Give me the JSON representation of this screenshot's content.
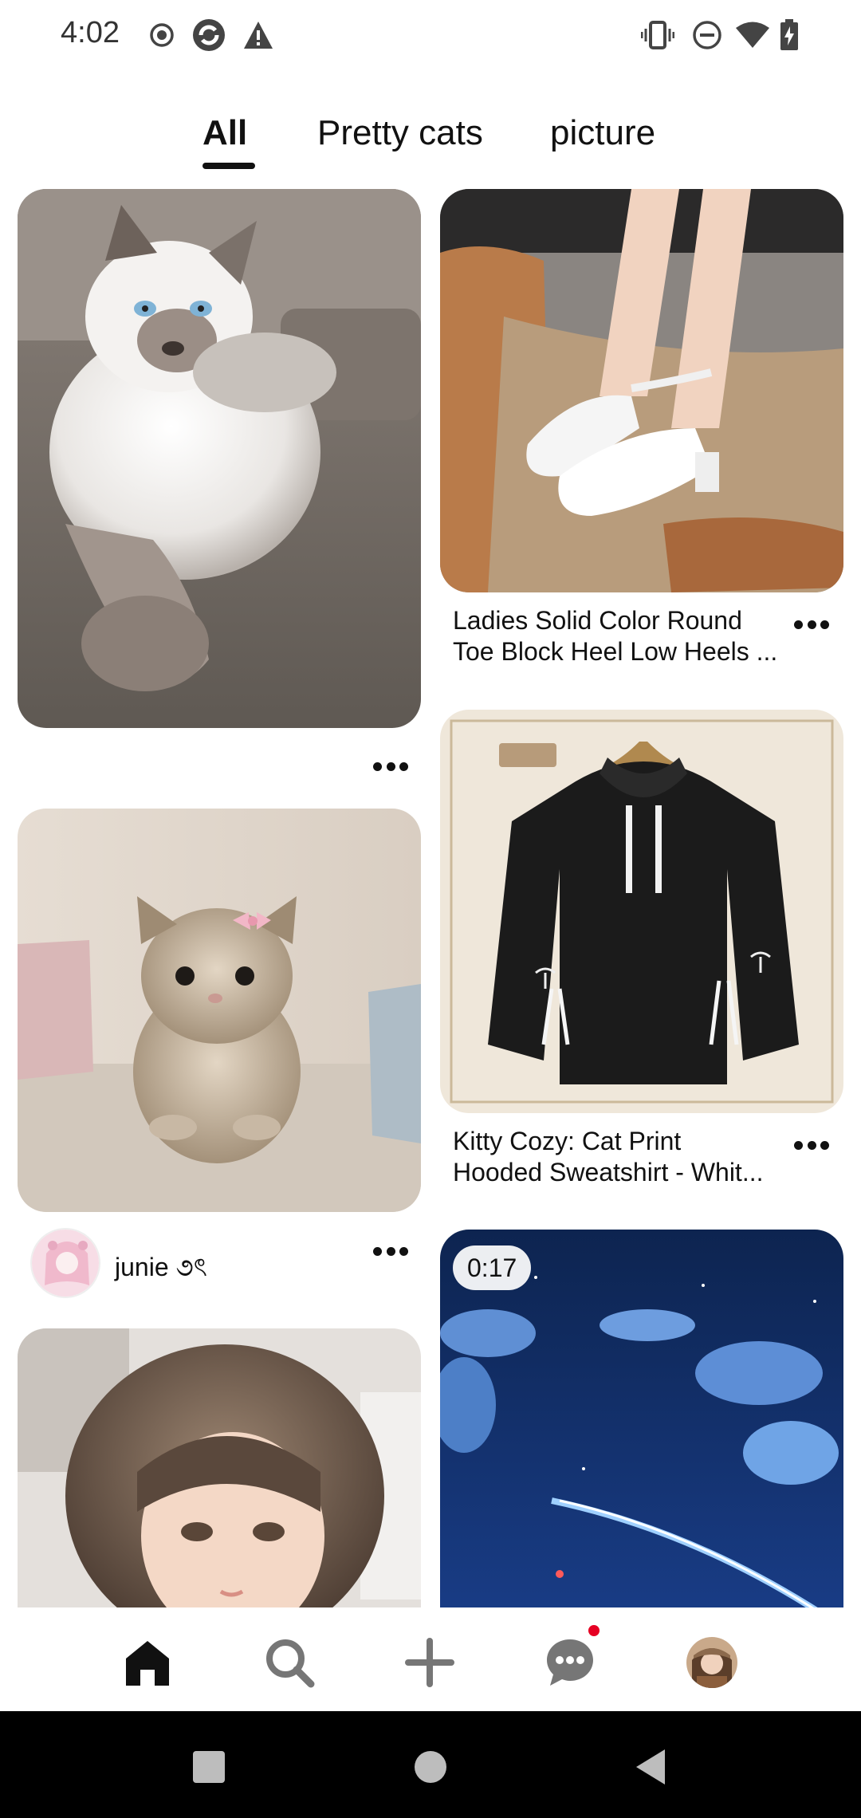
{
  "status_bar": {
    "time": "4:02",
    "icons_left": [
      "record-icon",
      "sync-app-icon",
      "warning-icon"
    ],
    "icons_right": [
      "vibrate-icon",
      "do-not-disturb-icon",
      "wifi-icon",
      "battery-charging-icon"
    ]
  },
  "tabs": [
    {
      "label": "All",
      "active": true
    },
    {
      "label": "Pretty cats",
      "active": false
    },
    {
      "label": "picture",
      "active": false
    }
  ],
  "feed": {
    "left_column": [
      {
        "image": "ragdoll cat lying on couch",
        "has_more": true
      },
      {
        "image": "fluffy kitten with pink bow",
        "creator": "junie ૭ৎ",
        "has_more": true
      },
      {
        "image": "illustrated girl with wavy hair"
      }
    ],
    "right_column": [
      {
        "image": "white block heel shoes",
        "title_line1": "Ladies Solid Color Round",
        "title_line2": "Toe Block Heel Low Heels ...",
        "has_more": true
      },
      {
        "image": "black cat print hoodie",
        "title_line1": "Kitty Cozy: Cat Print",
        "title_line2": "Hooded Sweatshirt - Whit...",
        "has_more": true
      },
      {
        "image": "night sky with comet",
        "video_duration": "0:17"
      }
    ]
  },
  "bottom_nav": {
    "items": [
      "home-icon",
      "search-icon",
      "create-icon",
      "messages-icon",
      "profile-avatar"
    ],
    "active": "home-icon",
    "messages_has_notification": true
  },
  "colors": {
    "accent": "#e60023",
    "text": "#111111",
    "background": "#ffffff"
  }
}
